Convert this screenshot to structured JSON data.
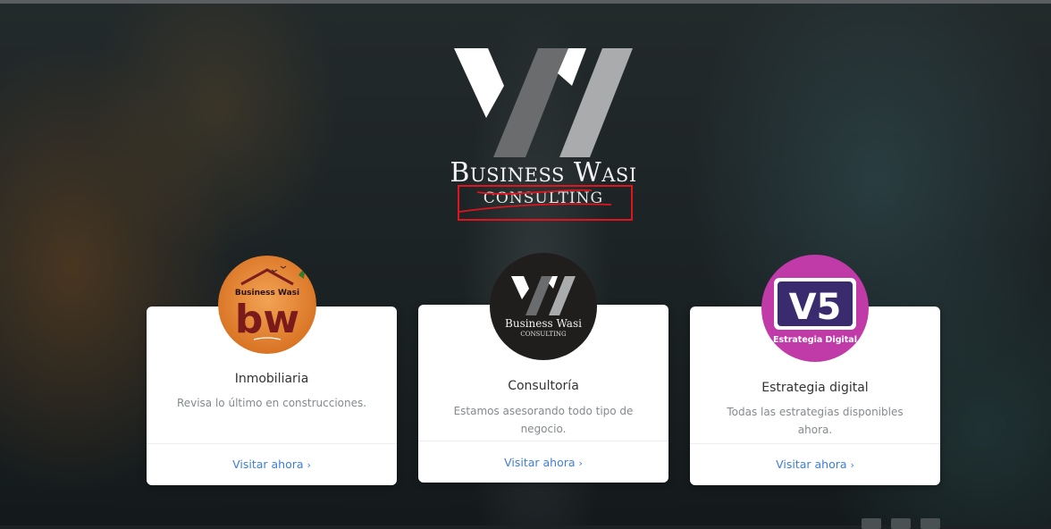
{
  "brand": {
    "name": "Business Wasi",
    "subtitle": "CONSULTING"
  },
  "cards": [
    {
      "title": "Inmobiliaria",
      "description": "Revisa lo último en construcciones.",
      "link": "Visitar ahora",
      "logo": {
        "top_text": "Business Wasi",
        "letters": "bw"
      }
    },
    {
      "title": "Consultoría",
      "description": "Estamos asesorando todo tipo de negocio.",
      "link": "Visitar ahora",
      "logo": {
        "name": "Business Wasi",
        "sub": "CONSULTING"
      }
    },
    {
      "title": "Estrategia digital",
      "description": "Todas las estrategias disponibles ahora.",
      "link": "Visitar ahora",
      "logo": {
        "mark": "V5",
        "caption": "Estrategia Digital"
      }
    }
  ],
  "colors": {
    "link": "#3f7fd9",
    "annotation": "#e0141e",
    "inmobiliaria_orange": "#e0822e",
    "v5_magenta": "#c03aa8",
    "v5_navy": "#3a2a6e"
  },
  "icons": [
    "chevron-right-icon"
  ]
}
